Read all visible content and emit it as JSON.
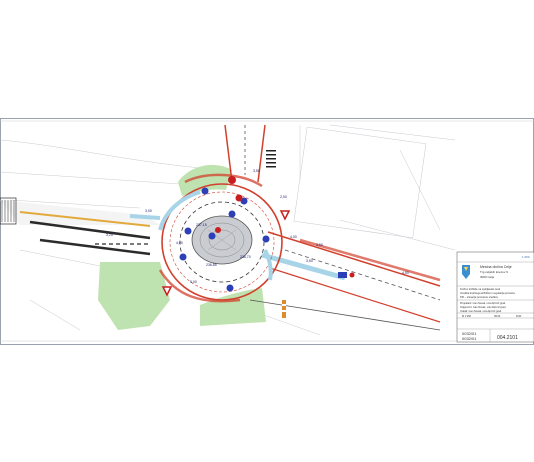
{
  "sheet": {
    "scale": "1:250",
    "labels": [
      "3,00",
      "3,50",
      "4,00",
      "3,25",
      "3,50",
      "5,00",
      "4,00",
      "2,00",
      "3,50",
      "4,50"
    ],
    "island_levels": [
      "236,70",
      "236,85",
      "237,15"
    ],
    "colors": {
      "frame": "#9aa3ad",
      "road_red": "#d2412e",
      "grass": "#bfe3b0",
      "island": "#c9ccd1",
      "blue_lane": "#a8d4e8",
      "sign_blue": "#2d3fb7",
      "sign_red": "#c81e1e"
    }
  },
  "title_block": {
    "municipality": "Mestna občina Celje",
    "address_line1": "Trg celjskih knezov 9",
    "address_line2": "3000 Celje",
    "project_lines": [
      "Krožno križišče na Ljubljanski cesti",
      "Izvedba krožnega križišča in regulacija prometa",
      "PZI – situacija prometne ureditve"
    ],
    "info_lines": [
      "Projektant: Ivan Novak, univ.dipl.inž.grad.",
      "Odgovorni: Ivan Novak, univ.dipl.inž.grad.",
      "Izdelal: Ivan Novak, univ.dipl.inž.grad."
    ],
    "small_fields": [
      "M 1:250",
      "05/13",
      "4/3/1"
    ],
    "code_top": "0032/01",
    "code_bottom": "0032/01",
    "drawing_number": "004.2101"
  }
}
